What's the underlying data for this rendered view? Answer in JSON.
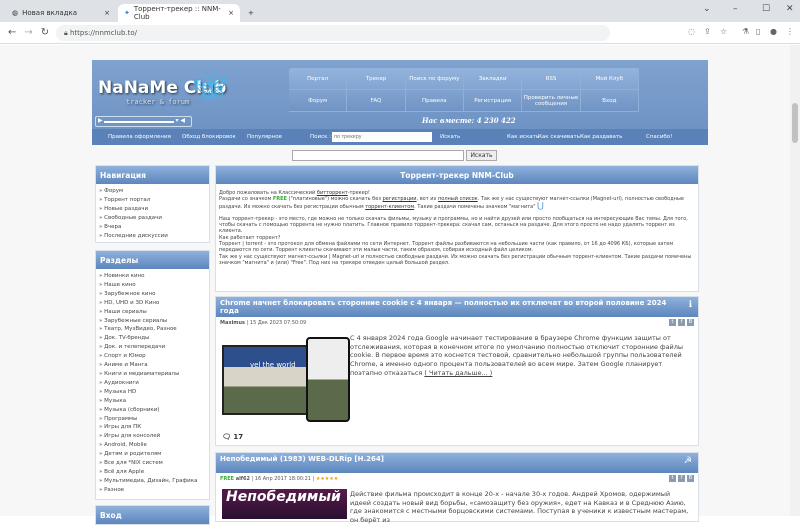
{
  "browser": {
    "tabs": [
      {
        "label": "Новая вкладка"
      },
      {
        "label": "Торрент-трекер :: NNM-Club"
      }
    ],
    "url": "https://nnmclub.to/"
  },
  "header": {
    "logo": "NaNaMe Club",
    "logo_sub": "tracker & forum",
    "menu": [
      "Портал",
      "Трекер",
      "Поиск по форуму",
      "Закладки",
      "RSS",
      "Мой Клуб",
      "Форум",
      "FAQ",
      "Правила",
      "Регистрация",
      "Проверить личные сообщения",
      "Вход"
    ],
    "online": "Нас вместе: 4 230 422",
    "strip": {
      "links_left": [
        "Правила оформления",
        "Обход блокировок",
        "Популярное"
      ],
      "search_label": "Поиск :",
      "search_placeholder": "по трекеру",
      "search_button": "Искать",
      "links_right": [
        "Как искать",
        "Как скачивать",
        "Как раздавать",
        "Спасибо!"
      ]
    }
  },
  "search": {
    "button": "Искать"
  },
  "nav": {
    "title": "Навигация",
    "items": [
      "» Форум",
      "» Торрент портал",
      "» Новые раздачи",
      "» Свободные раздачи",
      "» Вчера",
      "» Последние дискуссии"
    ]
  },
  "sections": {
    "title": "Разделы",
    "items": [
      "» Новинки кино",
      "» Наше кино",
      "» Зарубежное кино",
      "» HD, UHD и 3D Кино",
      "» Наши сериалы",
      "» Зарубежные сериалы",
      "» Театр, МузВидео, Разное",
      "» Док. TV-бренды",
      "» Док. и телепередачи",
      "» Спорт и Юмор",
      "» Аниме и Манга",
      "» Книги и медиаматериалы",
      "» Аудиокниги",
      "» Музыка HD",
      "» Музыка",
      "» Музыка (сборники)",
      "» Программы",
      "» Игры для ПК",
      "» Игры для консолей",
      "» Android, Mobile",
      "» Детям и родителям",
      "» Все для *NIX систем",
      "» Всё для Apple",
      "» Мультимедиа, Дизайн, Графика",
      "» Разное"
    ]
  },
  "login": {
    "title": "Вход"
  },
  "intro": {
    "title": "Торрент-трекер NNM-Club",
    "p1a": "Добро пожаловать на Классический ",
    "p1link": "битторрент",
    "p1b": "-трекер!",
    "p2a": "Раздачи со значком ",
    "free": "FREE",
    "p2b": " (\"платиновые\") можно скачать без ",
    "p2link1": "регистрации",
    "p2c": ", вот их ",
    "p2link2": "полный список",
    "p2d": ". Так же у нас существуют магнет-ссылки (Magnet-url), полностью свободные раздачи. Их можно скачать без регистрации обычным ",
    "p2link3": "торрент-клиентом",
    "p2e": ". Такие раздачи помечены значком \"магнита\"",
    "p3": "Наш торрент-трекер - это место, где можно не только скачать фильмы, музыку и программы, но и найти друзей или просто пообщаться на интересующие Вас темы. Для того, чтобы скачать с помощью торрента не нужно платить. Главное правило торрент-трекера: скачал сам, останься на раздаче. Для этого просто не надо удалять торрент из клиента.",
    "p4": "Как работает торрент?",
    "p5": "Торрент | torrent - это протокол для обмена файлами по сети Интернет. Торрент файлы разбиваются на небольшие части (как правило, от 16 до 4096 КБ), которые затем передаются по сети. Торрент клиенты скачивают эти малые части, таким образом, собирая исходный файл целиком.",
    "p6": "Так же у нас существуют магнет-ссылки | Magnet-url и полностью свободные раздачи. Их можно скачать без регистрации обычным торрент-клиентом. Такие раздачи помечены значком \"магнита\" и (или) \"Free\". Под них на трекере отведен целый большой раздел."
  },
  "news": [
    {
      "title": "Chrome начнет блокировать сторонние cookie с 4 января — полностью их отключат во второй половине 2024 года",
      "author": "Maximus",
      "date": " | 15 Дек 2023 07:50:09",
      "text": "С 4 января 2024 года Google начинает тестирование в браузере Chrome функции защиты от отслеживания, которая в конечном итоге по умолчанию полностью отключит сторонние файлы cookie. В первое время это коснется тестовой, сравнительно небольшой группы пользователей Chrome, а именно одного процента пользователей во всем мире. Затем Google планирует поэтапно отказаться ",
      "more": "( Читать дальше... )",
      "comments": "17",
      "image_caption": "vel the world"
    },
    {
      "title": "Непобедимый (1983) WEB-DLRip [H.264]",
      "free": "FREE",
      "author": "alf62",
      "date": " | 16 Апр 2017 18:00:21 | ",
      "stars": "★★★★★",
      "text": "Действие фильма происходит в конце 20-х - начале 30-х годов. Андрей Хромов, одержимый идеей создать новый вид борьбы, «самозащиту без оружия», едет на Кавказ и в Среднюю Азию, где знакомится с местными борцовскими системами. Поступая в ученики к известным мастерам, он берёт из",
      "poster": "Непобедимый"
    }
  ]
}
